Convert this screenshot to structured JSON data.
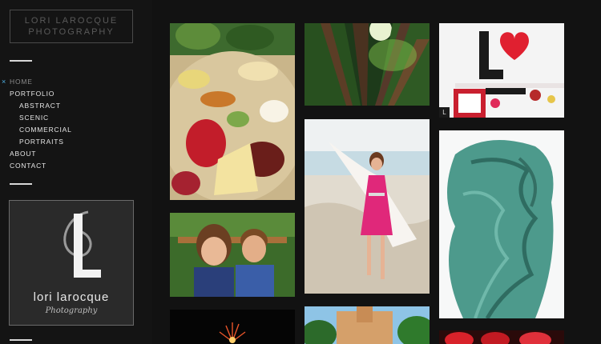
{
  "site": {
    "title_line1": "LORI LAROCQUE",
    "title_line2": "PHOTOGRAPHY"
  },
  "nav": {
    "items": [
      {
        "label": "HOME",
        "active": true
      },
      {
        "label": "PORTFOLIO"
      },
      {
        "label": "ABSTRACT",
        "sub": true
      },
      {
        "label": "SCENIC",
        "sub": true
      },
      {
        "label": "COMMERCIAL",
        "sub": true
      },
      {
        "label": "PORTRAITS",
        "sub": true
      },
      {
        "label": "ABOUT"
      },
      {
        "label": "CONTACT"
      }
    ],
    "active_marker": "×"
  },
  "brand_card": {
    "name": "lori larocque",
    "tagline": "Photography"
  },
  "gallery": {
    "tiles": [
      {
        "name": "charcuterie-board-photo"
      },
      {
        "name": "forest-canopy-photo"
      },
      {
        "name": "love-valentines-photo",
        "badge": "L"
      },
      {
        "name": "beach-girl-pink-dress-photo"
      },
      {
        "name": "statue-of-liberty-drape-photo"
      },
      {
        "name": "children-portrait-photo"
      },
      {
        "name": "fireworks-photo"
      },
      {
        "name": "balboa-park-tower-photo"
      },
      {
        "name": "red-roses-photo"
      }
    ]
  }
}
